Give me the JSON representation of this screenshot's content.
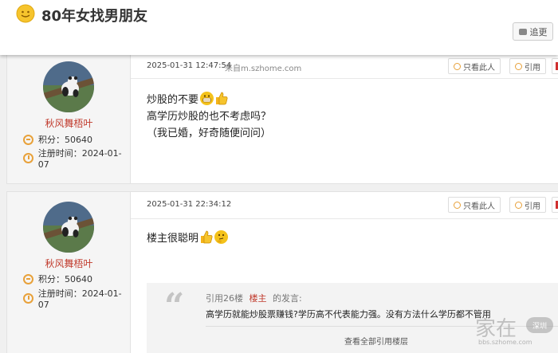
{
  "header": {
    "title": "80年女找男朋友",
    "reply_label": "追更",
    "icon": "smiley-icon"
  },
  "posts": [
    {
      "time": "2025-01-31 12:47:54",
      "source": "来自m.szhome.com",
      "btn_only": "只看此人",
      "btn_quote": "引用",
      "user": {
        "name": "秋风舞梧叶",
        "points_label": "积分：50640",
        "reg_label": "注册时间：2024-01-07"
      },
      "lines": [
        "炒股的不要",
        "高学历炒股的也不考虑吗？",
        "（我已婚，好奇随便问问）"
      ]
    },
    {
      "time": "2025-01-31 22:34:12",
      "btn_only": "只看此人",
      "btn_quote": "引用",
      "user": {
        "name": "秋风舞梧叶",
        "points_label": "积分：50640",
        "reg_label": "注册时间：2024-01-07"
      },
      "lines": [
        "楼主很聪明"
      ],
      "quote": {
        "prefix": "引用26楼",
        "author": "楼主",
        "suffix": "的发言:",
        "body": "高学历就能炒股票赚钱?学历高不代表能力强。没有方法什么学历都不管用",
        "more": "查看全部引用楼层"
      }
    }
  ],
  "watermark": {
    "main": "家在",
    "sub": "bbs.szhome.com",
    "badge": "深圳"
  },
  "colors": {
    "username": "#c0392b",
    "accent_icon": "#e8a13a",
    "sidebar_bg": "#f5f5f5"
  }
}
